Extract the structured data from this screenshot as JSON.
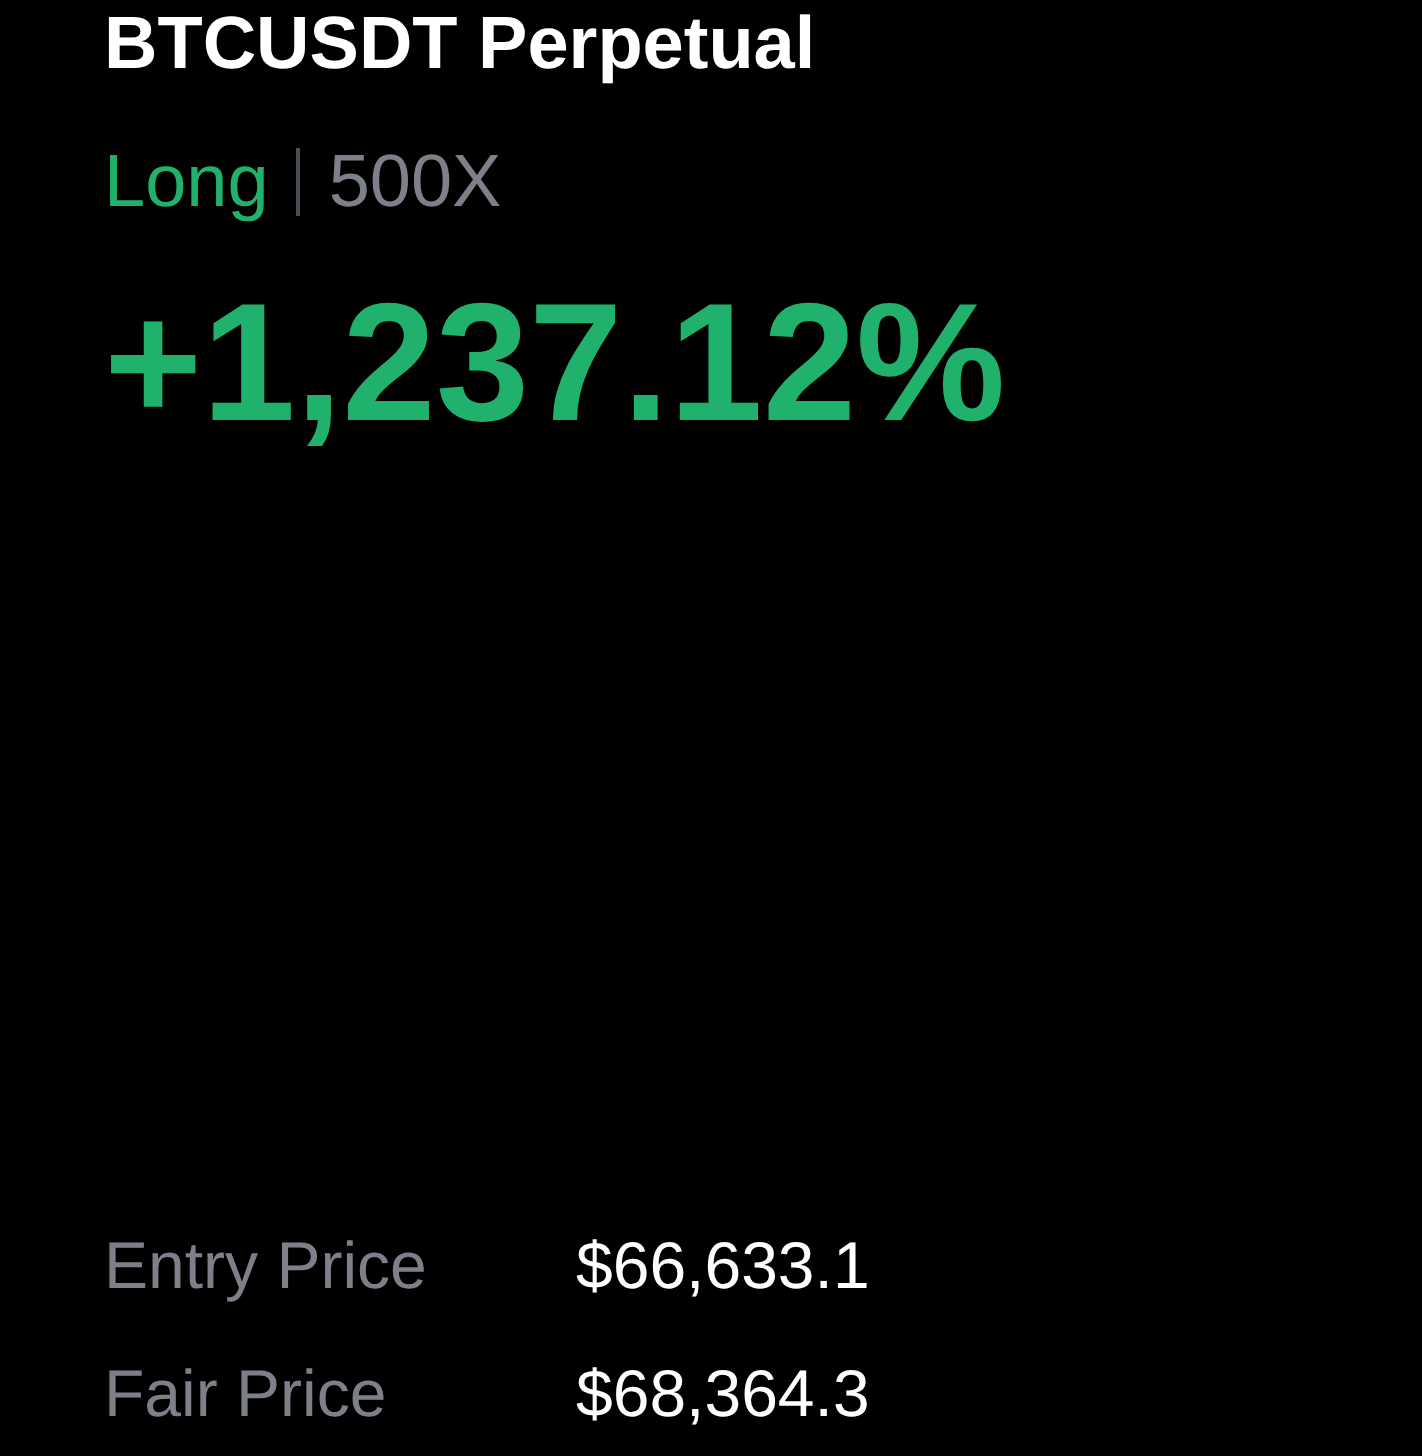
{
  "title": "BTCUSDT Perpetual",
  "position": {
    "side": "Long",
    "kind": "long",
    "leverage": "500X"
  },
  "roi": "+1,237.12%",
  "prices": [
    {
      "label": "Entry Price",
      "value": "$66,633.1"
    },
    {
      "label": "Fair Price",
      "value": "$68,364.3"
    }
  ]
}
